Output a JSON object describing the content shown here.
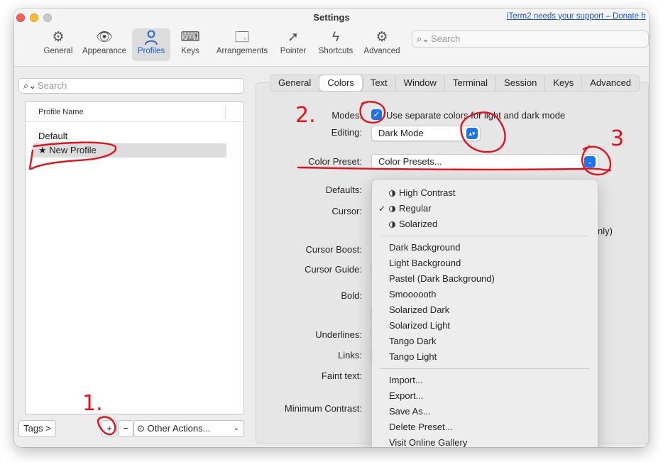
{
  "window": {
    "title": "Settings",
    "support_link": "iTerm2 needs your support – Donate h"
  },
  "toolbar": {
    "items": [
      {
        "label": "General",
        "icon": "gear-icon"
      },
      {
        "label": "Appearance",
        "icon": "eye-icon"
      },
      {
        "label": "Profiles",
        "icon": "person-icon"
      },
      {
        "label": "Keys",
        "icon": "keyboard-icon"
      },
      {
        "label": "Arrangements",
        "icon": "windows-icon"
      },
      {
        "label": "Pointer",
        "icon": "cursor-arrow-icon"
      },
      {
        "label": "Shortcuts",
        "icon": "bolt-icon"
      },
      {
        "label": "Advanced",
        "icon": "gears-icon"
      }
    ],
    "active": "Profiles",
    "search_placeholder": "Search"
  },
  "profiles": {
    "search_placeholder": "Search",
    "column_header": "Profile Name",
    "rows": [
      "Default",
      "★ New Profile"
    ],
    "selected": "★ New Profile",
    "tags_button": "Tags >",
    "add_button": "+",
    "remove_button": "−",
    "other_actions": "Other Actions..."
  },
  "tabs": [
    "General",
    "Colors",
    "Text",
    "Window",
    "Terminal",
    "Session",
    "Keys",
    "Advanced"
  ],
  "active_tab": "Colors",
  "colors": {
    "modes_label": "Modes:",
    "modes_checkbox_label": "Use separate colors for light and dark mode",
    "modes_checked": true,
    "editing_label": "Editing:",
    "editing_value": "Dark Mode",
    "preset_label": "Color Preset:",
    "preset_value": "Color Presets...",
    "defaults_label": "Defaults:",
    "cursor_label": "Cursor:",
    "partial_text": "nly)",
    "cursor_boost_label": "Cursor Boost:",
    "cursor_guide_label": "Cursor Guide:",
    "bold_label": "Bold:",
    "underlines_label": "Underlines:",
    "links_label": "Links:",
    "faint_label": "Faint text:",
    "min_contrast_label": "Minimum Contrast:"
  },
  "preset_menu": {
    "group1": [
      {
        "label": "High Contrast",
        "checked": false
      },
      {
        "label": "Regular",
        "checked": true
      },
      {
        "label": "Solarized",
        "checked": false
      }
    ],
    "group2": [
      "Dark Background",
      "Light Background",
      "Pastel (Dark Background)",
      "Smoooooth",
      "Solarized Dark",
      "Solarized Light",
      "Tango Dark",
      "Tango Light"
    ],
    "group3": [
      "Import...",
      "Export...",
      "Save As...",
      "Delete Preset...",
      "Visit Online Gallery"
    ]
  },
  "annotations": {
    "step1": "1.",
    "step2": "2.",
    "step3": "3",
    "ink_color": "#e0121c"
  }
}
